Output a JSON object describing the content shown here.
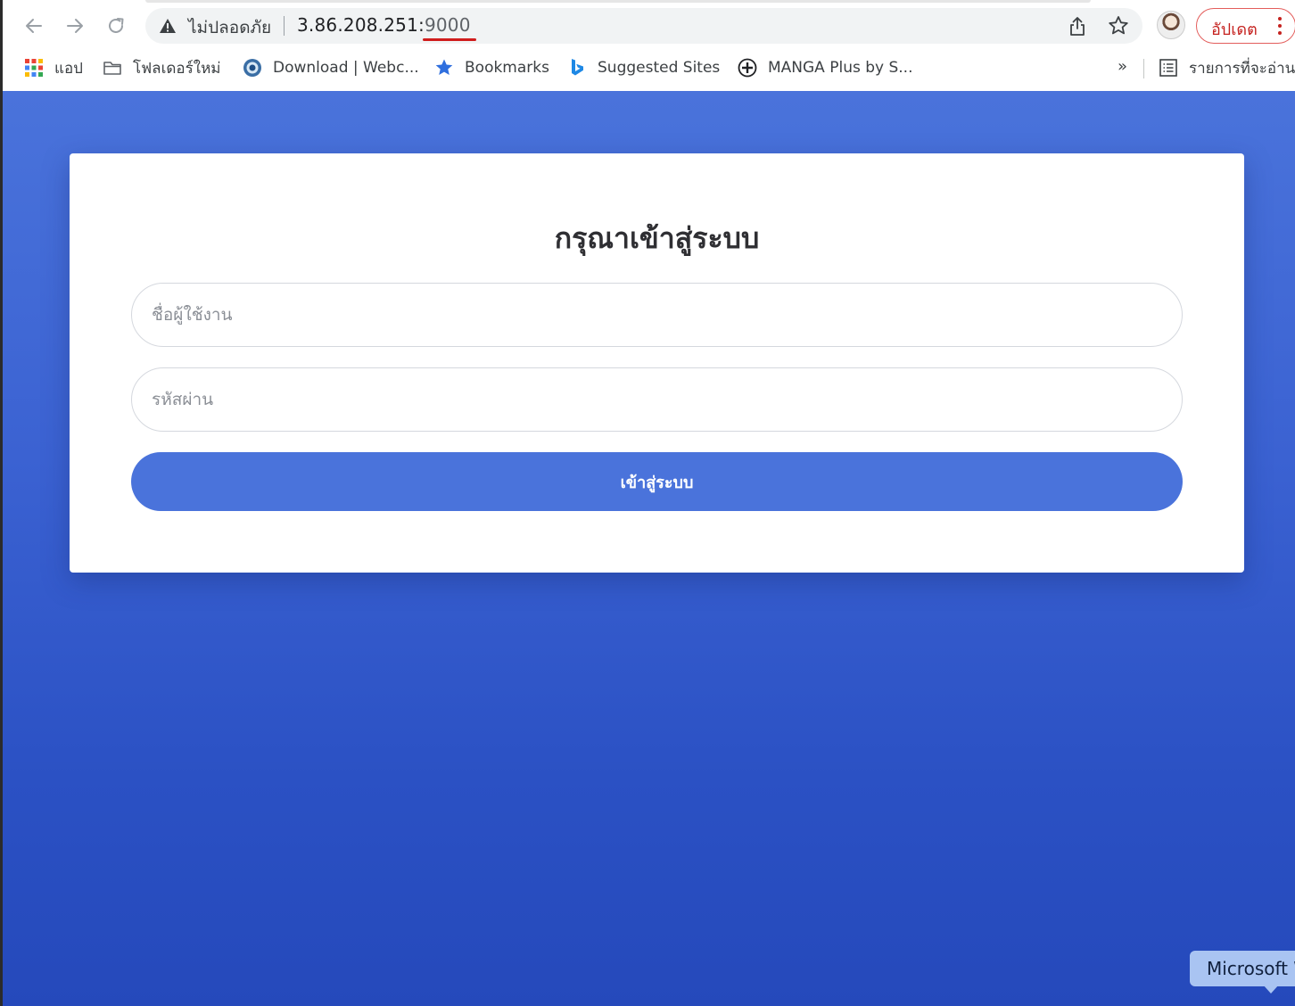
{
  "browser": {
    "security_label": "ไม่ปลอดภัย",
    "url_host": "3.86.208.251:",
    "url_port": "9000",
    "update_label": "อัปเดต",
    "bookmarks": [
      {
        "label": "แอป",
        "icon": "apps-grid-icon"
      },
      {
        "label": "โฟลเดอร์ใหม่",
        "icon": "folder-icon"
      },
      {
        "label": "Download | Webc...",
        "icon": "webcam-icon"
      },
      {
        "label": "Bookmarks",
        "icon": "star-icon"
      },
      {
        "label": "Suggested Sites",
        "icon": "bing-icon"
      },
      {
        "label": "MANGA Plus by S...",
        "icon": "manga-plus-icon"
      }
    ],
    "more_bookmarks": "»",
    "reading_list_label": "รายการที่จะอ่าน"
  },
  "login": {
    "title": "กรุณาเข้าสู่ระบบ",
    "username_placeholder": "ชื่อผู้ใช้งาน",
    "password_placeholder": "รหัสผ่าน",
    "submit_label": "เข้าสู่ระบบ"
  },
  "tooltip": {
    "text": "Microsoft W"
  },
  "colors": {
    "page_background": "#3b62d2",
    "button_background": "#4a73db",
    "update_accent": "#c5221f",
    "port_underline": "#d01c1c"
  }
}
